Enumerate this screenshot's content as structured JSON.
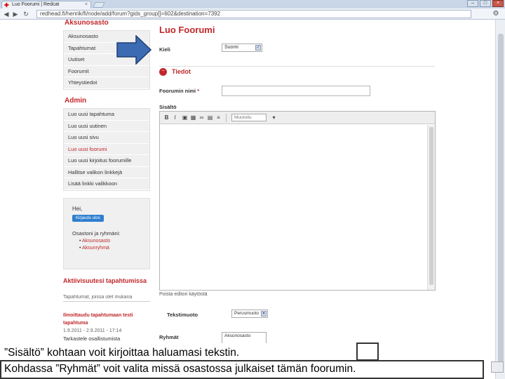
{
  "browser": {
    "tab_title": "Luo Foorumi | Redcat",
    "tab_close": "×",
    "url": "redhead.fi/henrik/fi/node/add/forum?gids_group[]=602&destination=7392",
    "win_min": "–",
    "win_max": "□",
    "win_close": "×"
  },
  "sidebar": {
    "section_title": "Aksunosasto",
    "section_items": [
      "Aksunosasto",
      "Tapahtumat",
      "Uutiset",
      "Foorumit",
      "Yhteystiedot"
    ],
    "admin_title": "Admin",
    "admin_items": [
      "Luo uusi tapahtuma",
      "Luo uusi uutinen",
      "Luo uusi sivu",
      "Luo uusi foorumi",
      "Luo uusi kirjoitus foorumille",
      "Hallitse valikon linkkejä",
      "Lisää linkki valikkoon"
    ],
    "active_admin_index": 3,
    "user": {
      "greeting": "Hei,",
      "logout_label": "Kirjaudu ulos",
      "groups_label": "Osastoni ja ryhmäni:",
      "groups": [
        "Aksunosasto",
        "Aksunryhmä"
      ]
    },
    "events": {
      "title": "Aktiivisuutesi tapahtumissa",
      "subtitle": "Tapahtumat, joissa olet mukana",
      "event_link": "Ilmoittaudu tapahtumaan testi tapahtuma",
      "event_date": "1.9.2011 - 2.9.2011 - 17:14",
      "manage_label": "Tarkastele osallistumista"
    }
  },
  "main": {
    "page_title": "Luo Foorumi",
    "lang_label": "Kieli",
    "lang_value": "Suomi",
    "fieldset_title": "Tiedot",
    "name_label": "Foorumin nimi",
    "required_mark": "*",
    "content_label": "Sisältö",
    "format_placeholder": "Muotoilu",
    "under_editor": "Poista editori käytöstä",
    "text_format_label": "Tekstimuoto",
    "text_format_value": "Perusmuoto",
    "groups_label": "Ryhmät",
    "groups_value": "Aksunosasto"
  },
  "caption": {
    "line1": "”Sisältö” kohtaan voit kirjoittaa haluamasi tekstin.",
    "line2": "Kohdassa ”Ryhmät” voit valita missä osastossa julkaiset tämän foorumin."
  },
  "colors": {
    "accent_red": "#c0282b",
    "arrow_fill": "#3d6bb3",
    "arrow_stroke": "#1f3f73"
  }
}
